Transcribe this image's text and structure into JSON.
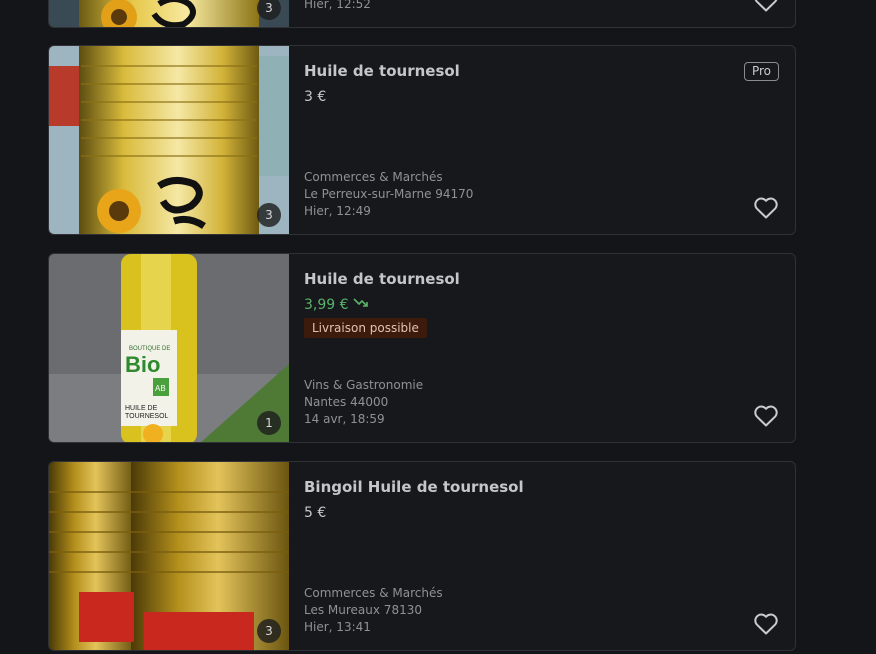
{
  "colors": {
    "background": "#141518",
    "card": "#17181b",
    "price_drop": "#59b36a",
    "delivery_badge": "#3c1a0c"
  },
  "listings": [
    {
      "title": "",
      "price": "",
      "photo_count": "3",
      "date": "Hier, 12:52",
      "icon": "heart-icon"
    },
    {
      "title": "Huile de tournesol",
      "price": "3 €",
      "badge": "Pro",
      "category": "Commerces & Marchés",
      "location": "Le Perreux-sur-Marne 94170",
      "date": "Hier, 12:49",
      "photo_count": "3",
      "icon": "heart-icon"
    },
    {
      "title": "Huile de tournesol",
      "price": "3,99 €",
      "price_trend_icon": "price-drop-icon",
      "delivery": "Livraison possible",
      "category": "Vins & Gastronomie",
      "location": "Nantes 44000",
      "date": "14 avr, 18:59",
      "photo_count": "1",
      "image_text": {
        "brand": "BOUTIQUE DE",
        "bio": "Bio",
        "ab": "AB",
        "label1": "HUILE DE",
        "label2": "TOURNESOL"
      },
      "icon": "heart-icon"
    },
    {
      "title": "Bingoil Huile de tournesol",
      "price": "5 €",
      "category": "Commerces & Marchés",
      "location": "Les Mureaux 78130",
      "date": "Hier, 13:41",
      "photo_count": "3",
      "icon": "heart-icon"
    }
  ]
}
